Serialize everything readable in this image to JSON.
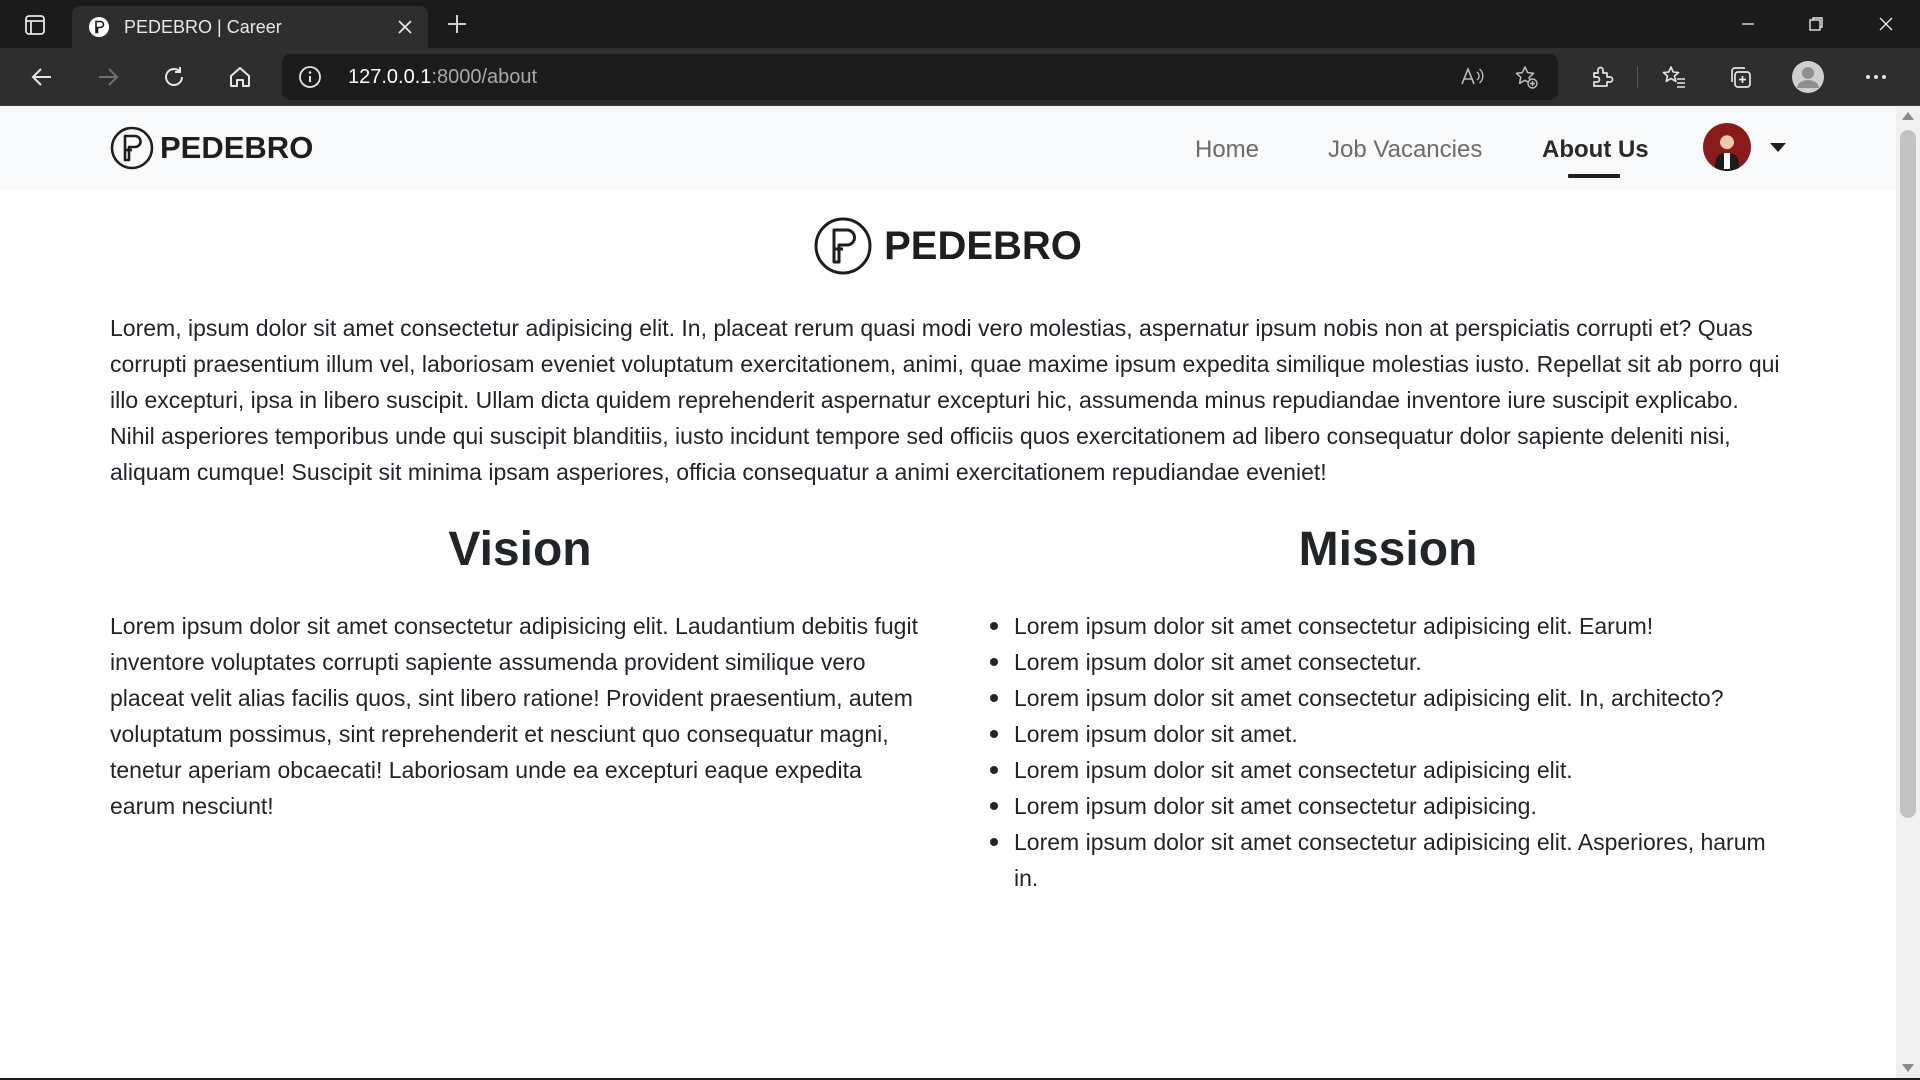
{
  "browser": {
    "tab_title": "PEDEBRO | Career",
    "url_host": "127.0.0.1",
    "url_path": ":8000/about"
  },
  "nav": {
    "brand": "PEDEBRO",
    "links": [
      "Home",
      "Job Vacancies",
      "About Us"
    ],
    "active": "About Us"
  },
  "hero": {
    "brand": "PEDEBRO"
  },
  "about": {
    "text": "Lorem, ipsum dolor sit amet consectetur adipisicing elit. In, placeat rerum quasi modi vero molestias, aspernatur ipsum nobis non at perspiciatis corrupti et? Quas corrupti praesentium illum vel, laboriosam eveniet voluptatum exercitationem, animi, quae maxime ipsum expedita similique molestias iusto. Repellat sit ab porro qui illo excepturi, ipsa in libero suscipit. Ullam dicta quidem reprehenderit aspernatur excepturi hic, assumenda minus repudiandae inventore iure suscipit explicabo. Nihil asperiores temporibus unde qui suscipit blanditiis, iusto incidunt tempore sed officiis quos exercitationem ad libero consequatur dolor sapiente deleniti nisi, aliquam cumque! Suscipit sit minima ipsam asperiores, officia consequatur a animi exercitationem repudiandae eveniet!"
  },
  "vision": {
    "title": "Vision",
    "text": "Lorem ipsum dolor sit amet consectetur adipisicing elit. Laudantium debitis fugit inventore voluptates corrupti sapiente assumenda provident similique vero placeat velit alias facilis quos, sint libero ratione! Provident praesentium, autem voluptatum possimus, sint reprehenderit et nesciunt quo consequatur magni, tenetur aperiam obcaecati! Laboriosam unde ea excepturi eaque expedita earum nesciunt!"
  },
  "mission": {
    "title": "Mission",
    "items": [
      "Lorem ipsum dolor sit amet consectetur adipisicing elit. Earum!",
      "Lorem ipsum dolor sit amet consectetur.",
      "Lorem ipsum dolor sit amet consectetur adipisicing elit. In, architecto?",
      "Lorem ipsum dolor sit amet.",
      "Lorem ipsum dolor sit amet consectetur adipisicing elit.",
      "Lorem ipsum dolor sit amet consectetur adipisicing.",
      "Lorem ipsum dolor sit amet consectetur adipisicing elit. Asperiores, harum in."
    ]
  },
  "icons": {
    "tab_actions": "tab-actions-icon",
    "back": "back-arrow-icon",
    "forward": "forward-arrow-icon",
    "refresh": "refresh-icon",
    "home": "home-icon",
    "site_info": "info-icon",
    "read_aloud": "read-aloud-icon",
    "add_favorite": "add-favorite-icon",
    "extensions": "extensions-icon",
    "favorites": "favorites-icon",
    "collections": "collections-icon",
    "profile": "profile-icon",
    "more": "more-icon"
  },
  "colors": {
    "chrome_dark": "#1b1b1b",
    "toolbar": "#2e2e2e",
    "navbar_bg": "#f8f9fa",
    "text": "#212529"
  }
}
